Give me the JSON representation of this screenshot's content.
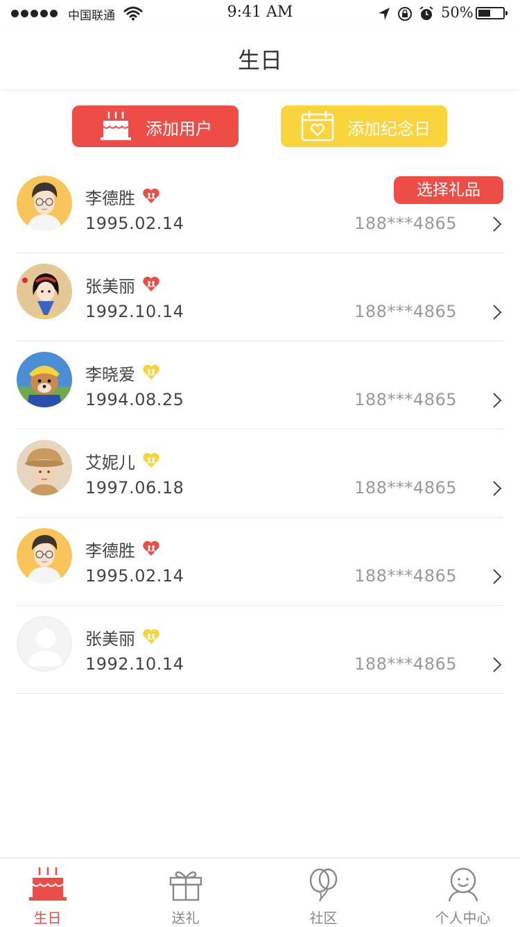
{
  "status_bar": {
    "carrier": "中国联通",
    "time": "9:41 AM",
    "battery_percent": "50%",
    "battery_level": 0.5
  },
  "nav": {
    "title": "生日"
  },
  "actions": {
    "add_user": "添加用户",
    "add_anniversary": "添加纪念日"
  },
  "select_gift_label": "选择礼品",
  "contacts": [
    {
      "name": "李德胜",
      "date": "1995.02.14",
      "phone": "188***4865",
      "badge": "red",
      "avatar": "man-glasses"
    },
    {
      "name": "张美丽",
      "date": "1992.10.14",
      "phone": "188***4865",
      "badge": "red",
      "avatar": "cartoon-princess"
    },
    {
      "name": "李晓爱",
      "date": "1994.08.25",
      "phone": "188***4865",
      "badge": "yellow",
      "avatar": "dog-yellow-hat"
    },
    {
      "name": "艾妮儿",
      "date": "1997.06.18",
      "phone": "188***4865",
      "badge": "yellow",
      "avatar": "child-hat"
    },
    {
      "name": "李德胜",
      "date": "1995.02.14",
      "phone": "188***4865",
      "badge": "red",
      "avatar": "man-glasses"
    },
    {
      "name": "张美丽",
      "date": "1992.10.14",
      "phone": "188***4865",
      "badge": "yellow",
      "avatar": "default-user"
    }
  ],
  "tabs": [
    {
      "label": "生日",
      "icon": "cake-icon",
      "active": true
    },
    {
      "label": "送礼",
      "icon": "gift-icon",
      "active": false
    },
    {
      "label": "社区",
      "icon": "balloon-icon",
      "active": false
    },
    {
      "label": "个人中心",
      "icon": "person-icon",
      "active": false
    }
  ],
  "colors": {
    "accent_red": "#ee4c47",
    "accent_yellow": "#fad43c",
    "text_dark": "#444444",
    "text_muted": "#999999",
    "tab_inactive": "#888888"
  }
}
